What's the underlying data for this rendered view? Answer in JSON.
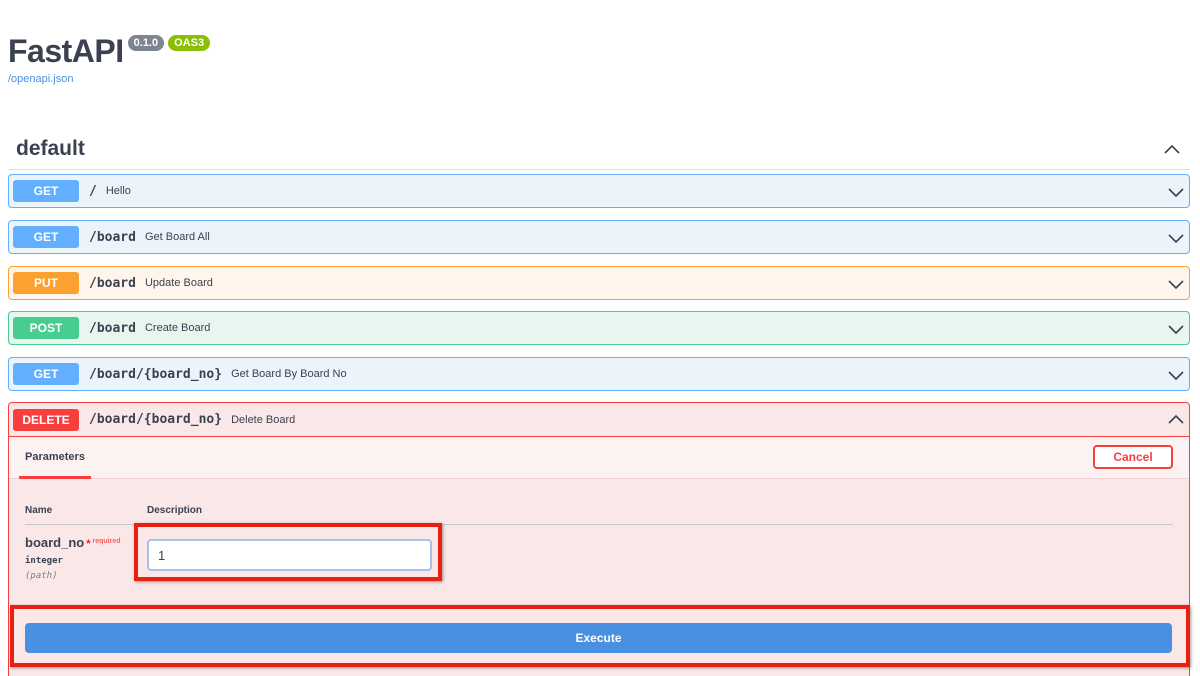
{
  "header": {
    "title": "FastAPI",
    "version": "0.1.0",
    "oas": "OAS3",
    "spec_link": "/openapi.json"
  },
  "section": {
    "title": "default"
  },
  "operations": [
    {
      "method": "GET",
      "path": "/",
      "summary": "Hello"
    },
    {
      "method": "GET",
      "path": "/board",
      "summary": "Get Board All"
    },
    {
      "method": "PUT",
      "path": "/board",
      "summary": "Update Board"
    },
    {
      "method": "POST",
      "path": "/board",
      "summary": "Create Board"
    },
    {
      "method": "GET",
      "path": "/board/{board_no}",
      "summary": "Get Board By Board No"
    }
  ],
  "expanded_op": {
    "method": "DELETE",
    "path": "/board/{board_no}",
    "summary": "Delete Board",
    "tab_label": "Parameters",
    "cancel_label": "Cancel",
    "col_name": "Name",
    "col_description": "Description",
    "param": {
      "name": "board_no",
      "star": "*",
      "required": "required",
      "type": "integer",
      "in": "(path)",
      "value": "1"
    },
    "execute_label": "Execute"
  },
  "colors": {
    "get": "#61affe",
    "put": "#fca130",
    "post": "#49cc90",
    "delete": "#f93e3e",
    "execute": "#4990e2",
    "highlight": "#e8200d"
  },
  "icons": {
    "collapse": "chevron-up-icon",
    "expand": "chevron-down-icon"
  }
}
